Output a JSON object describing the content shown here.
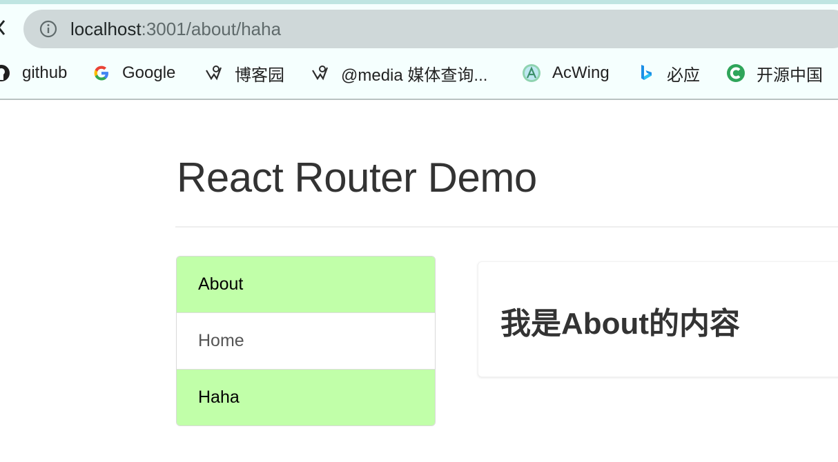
{
  "browser": {
    "url_host": "localhost",
    "url_rest": ":3001/about/haha"
  },
  "bookmarks": [
    {
      "label": "github",
      "icon": "github-icon"
    },
    {
      "label": "Google",
      "icon": "google-icon"
    },
    {
      "label": "博客园",
      "icon": "cnblogs-icon"
    },
    {
      "label": "@media 媒体查询...",
      "icon": "cnblogs-icon"
    },
    {
      "label": "AcWing",
      "icon": "acwing-icon"
    },
    {
      "label": "必应",
      "icon": "bing-icon"
    },
    {
      "label": "开源中国",
      "icon": "oschina-icon"
    }
  ],
  "page": {
    "title": "React Router Demo"
  },
  "nav": {
    "items": [
      {
        "label": "About",
        "active": true
      },
      {
        "label": "Home",
        "active": false
      },
      {
        "label": "Haha",
        "active": true
      }
    ]
  },
  "panel": {
    "heading": "我是About的内容"
  },
  "colors": {
    "active_bg": "#c1ffa9",
    "chrome_bg": "#f5fffe",
    "address_bar_bg": "#cfd8d9"
  }
}
